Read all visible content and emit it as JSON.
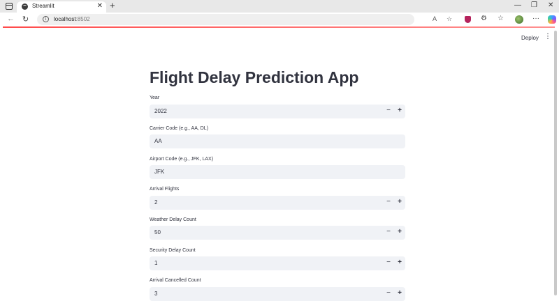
{
  "browser": {
    "tab_title": "Streamlit",
    "tab_close": "✕",
    "new_tab": "+",
    "url_host": "localhost",
    "url_port": ":8502",
    "window_controls": {
      "minimize": "—",
      "restore": "❐",
      "close": "✕"
    }
  },
  "app": {
    "deploy_label": "Deploy",
    "menu_label": "⋮",
    "title": "Flight Delay Prediction App"
  },
  "fields": {
    "year": {
      "label": "Year",
      "value": "2022"
    },
    "carrier": {
      "label": "Carrier Code (e.g., AA, DL)",
      "value": "AA"
    },
    "airport": {
      "label": "Airport Code (e.g., JFK, LAX)",
      "value": "JFK"
    },
    "arrival_flights": {
      "label": "Arrival Flights",
      "value": "2"
    },
    "weather_delay": {
      "label": "Weather Delay Count",
      "value": "50"
    },
    "security_delay": {
      "label": "Security Delay Count",
      "value": "1"
    },
    "arrival_cancelled": {
      "label": "Arrival Cancelled Count",
      "value": "3"
    }
  },
  "stepper": {
    "minus": "−",
    "plus": "+"
  }
}
